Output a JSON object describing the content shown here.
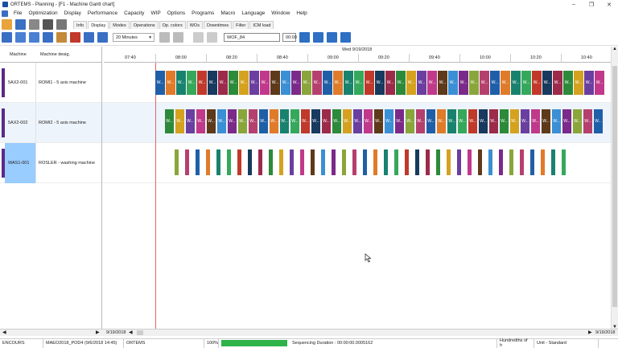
{
  "window": {
    "title": "ORTEMS - Planning - [F1 - Machine Gantt chart]"
  },
  "menu": [
    "File",
    "Optimization",
    "Display",
    "Performance",
    "Capacity",
    "WIP",
    "Options",
    "Programs",
    "Macro",
    "Language",
    "Window",
    "Help"
  ],
  "tabs": [
    "Info",
    "Display",
    "Modes",
    "Operations",
    "Op. colors",
    "WOs",
    "Downtimes",
    "Filter",
    "ICM load"
  ],
  "toolbar": {
    "zoom": "20 Minutes",
    "wo_field": "WOF_84",
    "time_field": "00:00"
  },
  "grid": {
    "col_machine": "Machine",
    "col_desig": "Machine desig.",
    "date_header": "Wed 9/19/2018",
    "ticks": [
      "07:40",
      "08:00",
      "08:20",
      "08:40",
      "09:00",
      "09:20",
      "09:40",
      "10:00",
      "10:20",
      "10:40"
    ],
    "rows": [
      {
        "code": "5AX2-001",
        "desc": "ROMI1 - 5 axis machine"
      },
      {
        "code": "5AX2-002",
        "desc": "ROMI2 - 5 axis machine"
      },
      {
        "code": "WAS1-001",
        "desc": "ROSLER - washing machine"
      }
    ],
    "bar_label": "W..."
  },
  "hscroll": {
    "left_date": "9/19/2018",
    "right_date": "9/19/2018"
  },
  "status": {
    "state": "ENCOURS",
    "file": "MAEO2018_POD4 (9/6/2018 14:45)",
    "app": "ORTEMS",
    "progress_label": "100%",
    "progress": 1.0,
    "duration": "Sequencing Duration : 00:00:00.0005162",
    "units": "Hundredths of h",
    "unit_mode": "Unit - Standard"
  },
  "colors": {
    "accent": "#1a4fa0",
    "row_bar": "#5b2a8a",
    "selected": "#99ccff",
    "progress": "#2db34a",
    "now_line": "#e06666"
  }
}
